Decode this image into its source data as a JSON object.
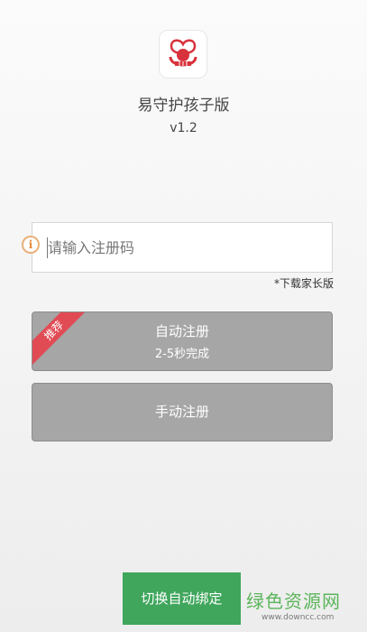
{
  "app": {
    "title": "易守护孩子版",
    "version": "v1.2",
    "logo_icon": "app-logo-icon",
    "accent": "#e14b54"
  },
  "register": {
    "placeholder": "请输入注册码",
    "value": "",
    "info_icon": "i",
    "download_link": "*下载家长版"
  },
  "buttons": {
    "auto_line1": "自动注册",
    "auto_line2": "2-5秒完成",
    "recommend_badge": "推荐",
    "manual": "手动注册",
    "switch": "切换自动绑定",
    "gray": "#a6a6a6",
    "green": "#3fa65c"
  },
  "watermark": {
    "site_name": "绿色资源网",
    "url": "www.downcc.com"
  }
}
